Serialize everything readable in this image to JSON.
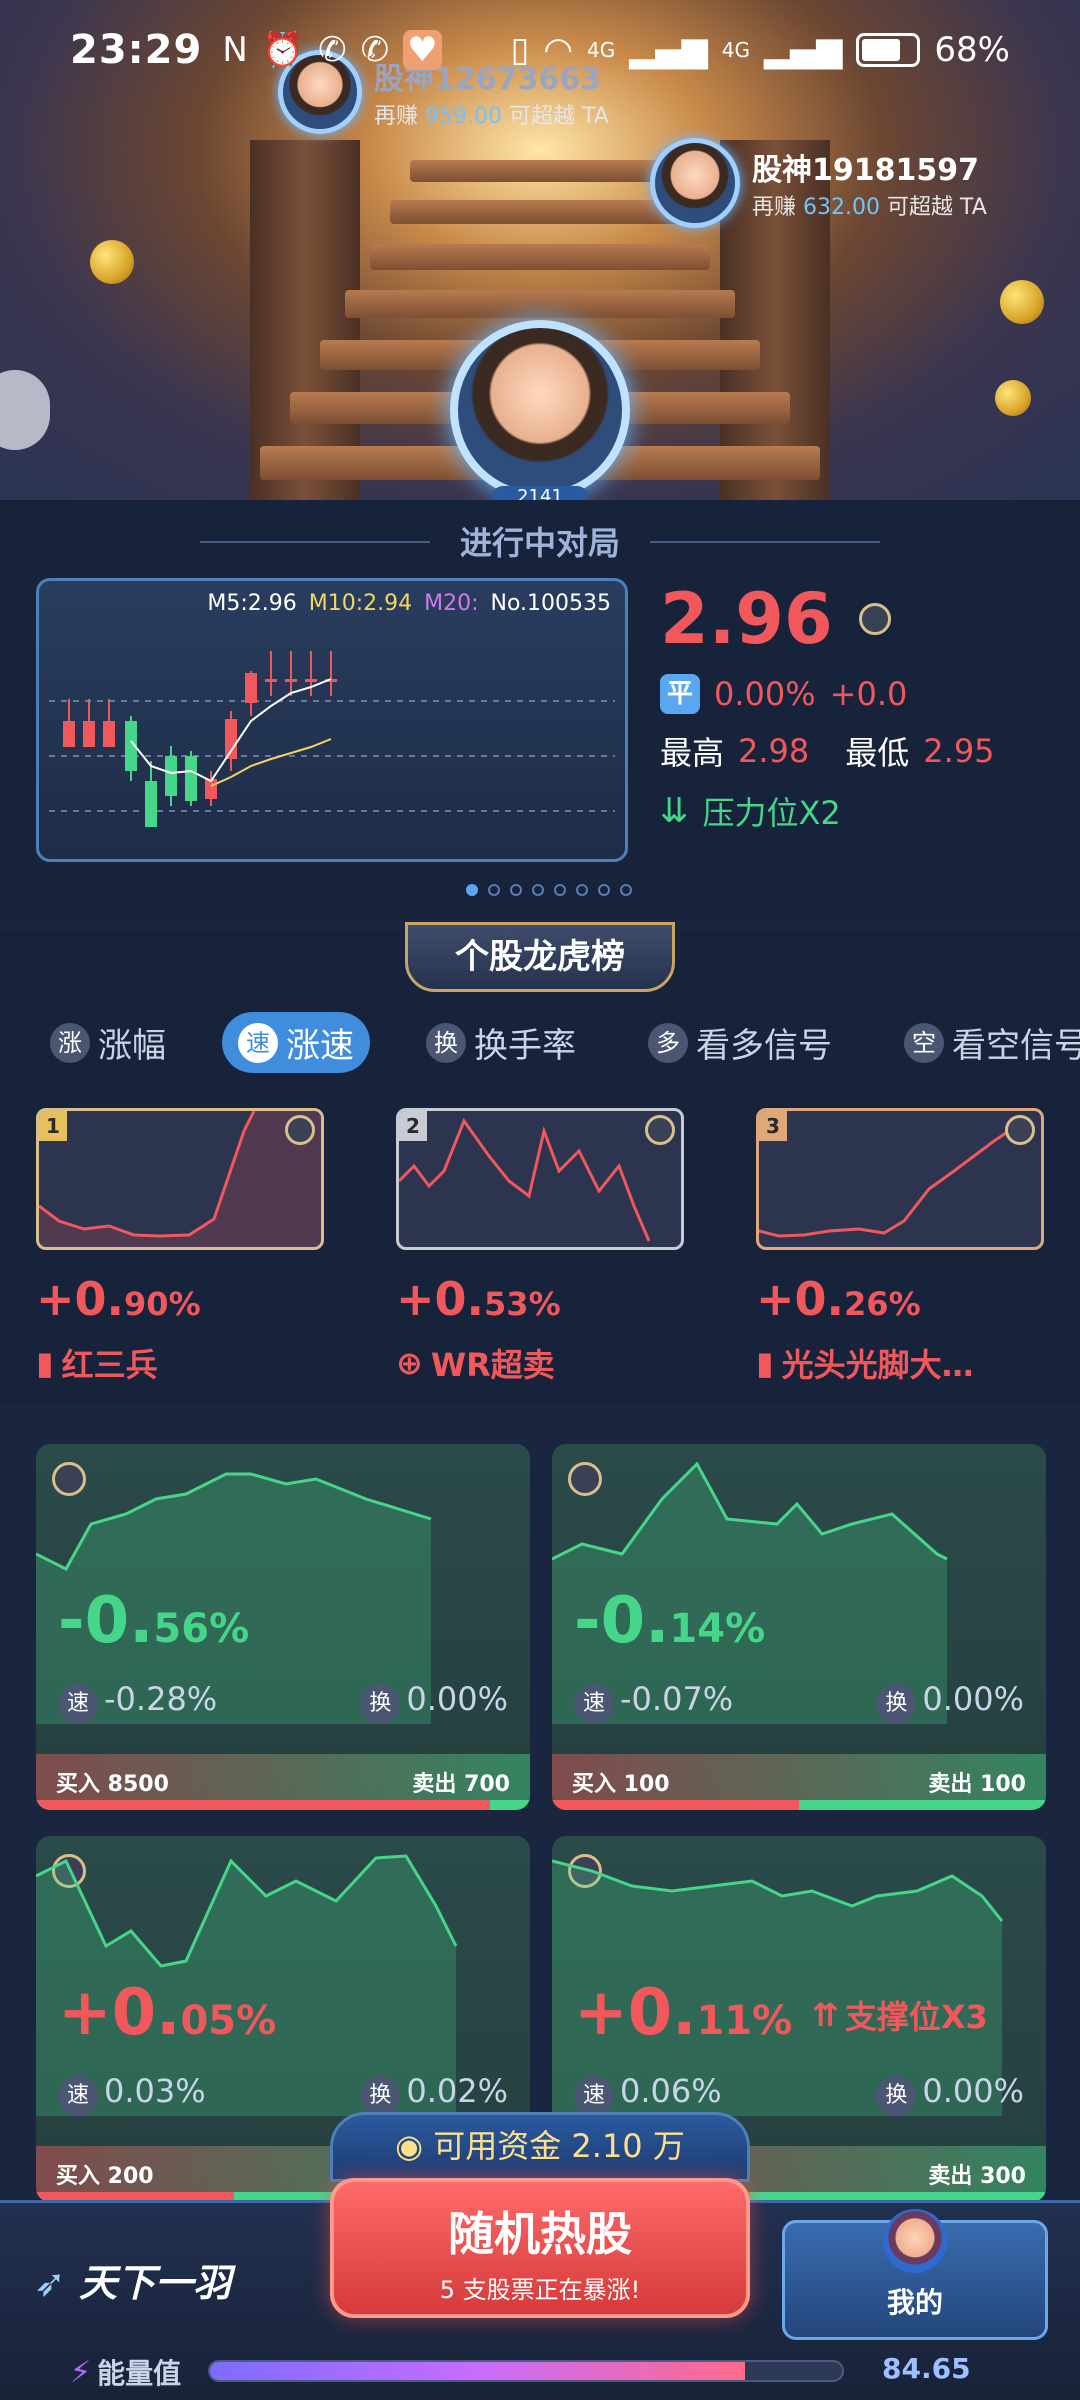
{
  "status_bar": {
    "time": "23:29",
    "battery": "68%",
    "network_1": "4G",
    "network_2": "4G"
  },
  "hero": {
    "top_player": {
      "name": "股神12673663",
      "sub_prefix": "再赚",
      "amount": "959.00",
      "sub_suffix": "可超越 TA"
    },
    "right_player": {
      "name": "股神19181597",
      "sub_prefix": "再赚",
      "amount": "632.00",
      "sub_suffix": "可超越 TA"
    },
    "main_player_tag": "2141"
  },
  "ongoing": {
    "title": "进行中对局",
    "legend": {
      "m5": "M5:2.96",
      "m10": "M10:2.94",
      "m20": "M20:",
      "no": "No.100535"
    },
    "price": "2.96",
    "flat_tag": "平",
    "change_pct": "0.00%",
    "change_val": "+0.0",
    "high_label": "最高",
    "high": "2.98",
    "low_label": "最低",
    "low": "2.95",
    "pressure": "压力位X2",
    "page_dots": 8,
    "page_active": 0
  },
  "board": {
    "title": "个股龙虎榜",
    "tabs": [
      {
        "icon": "涨",
        "label": "涨幅"
      },
      {
        "icon": "速",
        "label": "涨速",
        "active": true
      },
      {
        "icon": "换",
        "label": "换手率"
      },
      {
        "icon": "多",
        "label": "看多信号"
      },
      {
        "icon": "空",
        "label": "看空信号"
      }
    ],
    "ranks": [
      {
        "rank": "1",
        "pct_big": "+0.",
        "pct_small": "90%",
        "label": "红三兵"
      },
      {
        "rank": "2",
        "pct_big": "+0.",
        "pct_small": "53%",
        "label": "WR超卖"
      },
      {
        "rank": "3",
        "pct_big": "+0.",
        "pct_small": "26%",
        "label": "光头光脚大…"
      }
    ]
  },
  "cards": [
    {
      "pct_big": "-0.",
      "pct_small": "56%",
      "speed": "-0.28%",
      "turnover": "0.00%",
      "buy": "买入 8500",
      "sell": "卖出 700",
      "buy_ratio": 0.92
    },
    {
      "pct_big": "-0.",
      "pct_small": "14%",
      "speed": "-0.07%",
      "turnover": "0.00%",
      "buy": "买入 100",
      "sell": "卖出 100",
      "buy_ratio": 0.5
    },
    {
      "pct_big": "+0.",
      "pct_small": "05%",
      "speed": "0.03%",
      "turnover": "0.02%",
      "buy": "买入 200",
      "sell": "",
      "buy_ratio": 0.4
    },
    {
      "pct_big": "+0.",
      "pct_small": "11%",
      "speed": "0.06%",
      "turnover": "0.00%",
      "buy": "",
      "sell": "卖出 300",
      "buy_ratio": 0.4,
      "tag": "支撑位X3"
    }
  ],
  "stat_icons": {
    "speed": "速",
    "turnover": "换"
  },
  "bottom": {
    "logo": "天下一羽",
    "fund": "可用资金 2.10 万",
    "hot_title": "随机热股",
    "hot_sub": "5 支股票正在暴涨!",
    "mine": "我的",
    "energy_label": "能量值",
    "energy_value": "84.65",
    "energy_pct": 0.8465
  }
}
